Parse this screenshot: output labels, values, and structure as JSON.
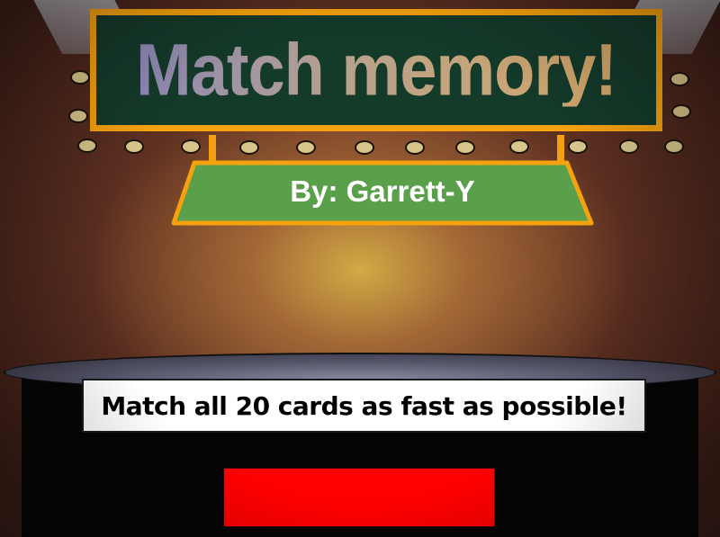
{
  "game": {
    "title": "Match memory!",
    "author": "By: Garrett-Y",
    "instruction": "Match all 20 cards as fast as possible!"
  },
  "colors": {
    "sign_border": "#f5a20e",
    "title_board": "#143a2a",
    "subtitle_board": "#5aa04a",
    "start_button": "#ff0000",
    "marquee_light": "#d8c58a"
  },
  "icons": [
    "marquee-light-bulb",
    "spotlight"
  ]
}
